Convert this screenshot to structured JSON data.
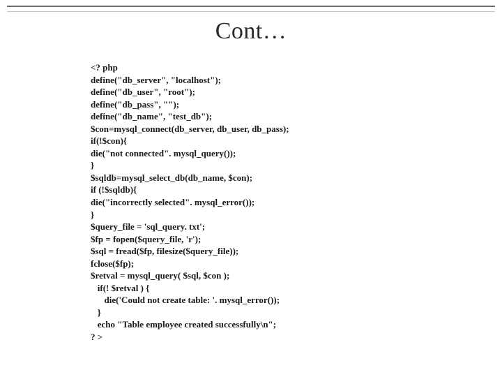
{
  "slide": {
    "title": "Cont…",
    "code_lines": [
      "<? php",
      "define(\"db_server\", \"localhost\");",
      "define(\"db_user\", \"root\");",
      "define(\"db_pass\", \"\");",
      "define(\"db_name\", \"test_db\");",
      "$con=mysql_connect(db_server, db_user, db_pass);",
      "if(!$con){",
      "die(\"not connected\". mysql_query());",
      "}",
      "$sqldb=mysql_select_db(db_name, $con);",
      "if (!$sqldb){",
      "die(\"incorrectly selected\". mysql_error());",
      "}",
      "$query_file = 'sql_query. txt';",
      "$fp = fopen($query_file, 'r');",
      "$sql = fread($fp, filesize($query_file));",
      "fclose($fp);",
      "$retval = mysql_query( $sql, $con );",
      "   if(! $retval ) {",
      "      die('Could not create table: '. mysql_error());",
      "   }",
      "   echo \"Table employee created successfully\\n\";",
      "? >"
    ]
  }
}
